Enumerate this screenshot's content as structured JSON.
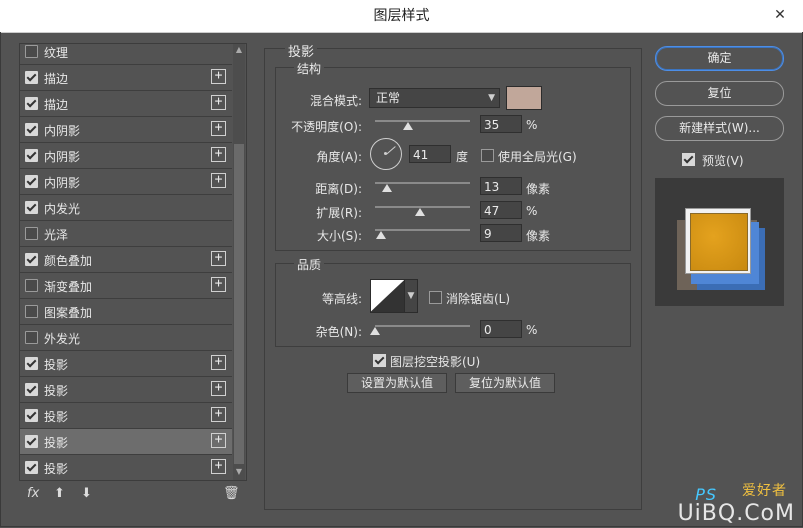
{
  "window": {
    "title": "图层样式",
    "close_glyph": "✕"
  },
  "styles": [
    {
      "label": "纹理",
      "checked": false,
      "plus": false
    },
    {
      "label": "描边",
      "checked": true,
      "plus": true
    },
    {
      "label": "描边",
      "checked": true,
      "plus": true
    },
    {
      "label": "内阴影",
      "checked": true,
      "plus": true
    },
    {
      "label": "内阴影",
      "checked": true,
      "plus": true
    },
    {
      "label": "内阴影",
      "checked": true,
      "plus": true
    },
    {
      "label": "内发光",
      "checked": true,
      "plus": false
    },
    {
      "label": "光泽",
      "checked": false,
      "plus": false
    },
    {
      "label": "颜色叠加",
      "checked": true,
      "plus": true
    },
    {
      "label": "渐变叠加",
      "checked": false,
      "plus": true
    },
    {
      "label": "图案叠加",
      "checked": false,
      "plus": false
    },
    {
      "label": "外发光",
      "checked": false,
      "plus": false
    },
    {
      "label": "投影",
      "checked": true,
      "plus": true
    },
    {
      "label": "投影",
      "checked": true,
      "plus": true
    },
    {
      "label": "投影",
      "checked": true,
      "plus": true
    },
    {
      "label": "投影",
      "checked": true,
      "plus": true,
      "selected": true
    },
    {
      "label": "投影",
      "checked": true,
      "plus": true
    }
  ],
  "toolbar": {
    "fx": "fx",
    "up": "⬆",
    "down": "⬇",
    "trash": "🗑"
  },
  "panel": {
    "title": "投影",
    "structure": {
      "title": "结构",
      "blend_label": "混合模式:",
      "blend_value": "正常",
      "blend_color": "#c1a79a",
      "opacity_label": "不透明度(O):",
      "opacity": "35",
      "opacity_fraction": 0.35,
      "pct": "%",
      "angle_label": "角度(A):",
      "angle": "41",
      "angle_unit": "度",
      "global_light_label": "使用全局光(G)",
      "global_light": false,
      "distance_label": "距离(D):",
      "distance": "13",
      "distance_fraction": 0.13,
      "px": "像素",
      "spread_label": "扩展(R):",
      "spread": "47",
      "spread_fraction": 0.47,
      "size_label": "大小(S):",
      "size": "9",
      "size_fraction": 0.06
    },
    "quality": {
      "title": "品质",
      "contour_label": "等高线:",
      "antialias_label": "消除锯齿(L)",
      "antialias": false,
      "noise_label": "杂色(N):",
      "noise": "0",
      "noise_fraction": 0.0,
      "knockout_label": "图层挖空投影(U)",
      "knockout": true,
      "set_default": "设置为默认值",
      "reset_default": "复位为默认值"
    }
  },
  "buttons": {
    "ok": "确定",
    "reset": "复位",
    "new_style": "新建样式(W)...",
    "preview_label": "预览(V)",
    "preview": true
  },
  "watermark": {
    "ps": "PS",
    "cn": "爱好者",
    "url": "UiBQ.CoM"
  }
}
